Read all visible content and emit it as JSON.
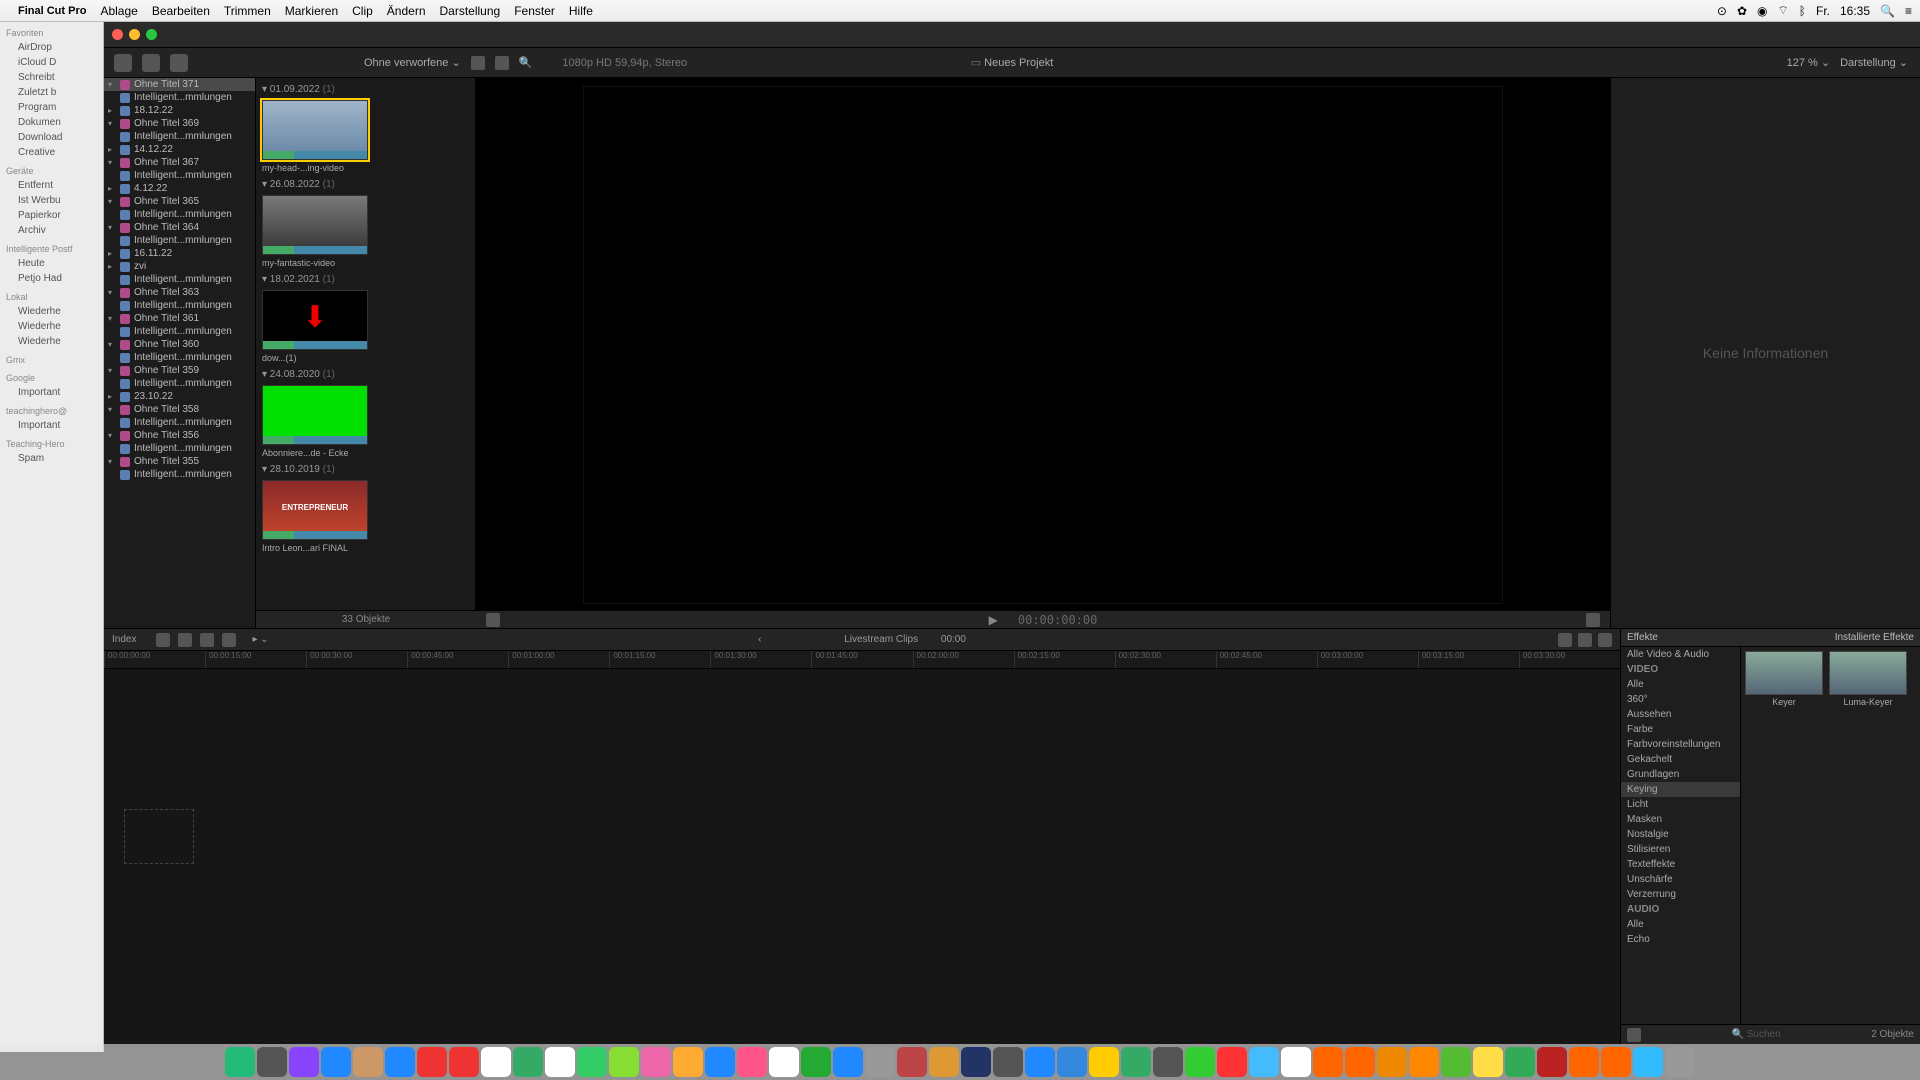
{
  "menubar": {
    "app": "Final Cut Pro",
    "items": [
      "Ablage",
      "Bearbeiten",
      "Trimmen",
      "Markieren",
      "Clip",
      "Ändern",
      "Darstellung",
      "Fenster",
      "Hilfe"
    ],
    "right": {
      "day": "Fr.",
      "time": "16:35"
    }
  },
  "finder": {
    "sections": [
      {
        "header": "Favoriten",
        "items": [
          "AirDrop",
          "iCloud D",
          "Schreibt",
          "Zuletzt b",
          "Program",
          "Dokumen",
          "Download",
          "Creative"
        ]
      },
      {
        "header": "Geräte",
        "items": [
          "Entfernt"
        ]
      },
      {
        "header": "",
        "items": [
          "Ist Werbu",
          "Papierkor",
          "Archiv"
        ]
      },
      {
        "header": "Intelligente Postf",
        "items": [
          "Heute",
          "Petjo Had"
        ]
      },
      {
        "header": "Lokal",
        "items": [
          "Wiederhe",
          "Wiederhe",
          "Wiederhe"
        ]
      },
      {
        "header": "Gmx",
        "items": []
      },
      {
        "header": "Google",
        "items": [
          "Important"
        ]
      },
      {
        "header": "teachinghero@",
        "items": [
          "Important"
        ]
      },
      {
        "header": "Teaching-Hero",
        "items": [
          "Spam"
        ]
      }
    ]
  },
  "toolbar": {
    "filter": "Ohne verworfene",
    "format": "1080p HD 59,94p, Stereo",
    "project": "Neues Projekt",
    "zoom": "127 %",
    "view": "Darstellung"
  },
  "library": {
    "items": [
      {
        "t": "▾",
        "ic": "star",
        "label": "Ohne Titel 371",
        "sel": true
      },
      {
        "t": "",
        "ic": "",
        "label": "Intelligent...mmlungen"
      },
      {
        "t": "▸",
        "ic": "",
        "label": "18.12.22"
      },
      {
        "t": "▾",
        "ic": "star",
        "label": "Ohne Titel 369"
      },
      {
        "t": "",
        "ic": "",
        "label": "Intelligent...mmlungen"
      },
      {
        "t": "▸",
        "ic": "",
        "label": "14.12.22"
      },
      {
        "t": "▾",
        "ic": "star",
        "label": "Ohne Titel 367"
      },
      {
        "t": "",
        "ic": "",
        "label": "Intelligent...mmlungen"
      },
      {
        "t": "▸",
        "ic": "",
        "label": "4.12.22"
      },
      {
        "t": "▾",
        "ic": "star",
        "label": "Ohne Titel 365"
      },
      {
        "t": "",
        "ic": "",
        "label": "Intelligent...mmlungen"
      },
      {
        "t": "▾",
        "ic": "star",
        "label": "Ohne Titel 364"
      },
      {
        "t": "",
        "ic": "",
        "label": "Intelligent...mmlungen"
      },
      {
        "t": "▸",
        "ic": "",
        "label": "16.11.22"
      },
      {
        "t": "▸",
        "ic": "",
        "label": "zvi"
      },
      {
        "t": "",
        "ic": "",
        "label": "Intelligent...mmlungen"
      },
      {
        "t": "▾",
        "ic": "star",
        "label": "Ohne Titel 363"
      },
      {
        "t": "",
        "ic": "",
        "label": "Intelligent...mmlungen"
      },
      {
        "t": "▾",
        "ic": "star",
        "label": "Ohne Titel 361"
      },
      {
        "t": "",
        "ic": "",
        "label": "Intelligent...mmlungen"
      },
      {
        "t": "▾",
        "ic": "star",
        "label": "Ohne Titel 360"
      },
      {
        "t": "",
        "ic": "",
        "label": "Intelligent...mmlungen"
      },
      {
        "t": "▾",
        "ic": "star",
        "label": "Ohne Titel 359"
      },
      {
        "t": "",
        "ic": "",
        "label": "Intelligent...mmlungen"
      },
      {
        "t": "▸",
        "ic": "",
        "label": "23.10.22"
      },
      {
        "t": "▾",
        "ic": "star",
        "label": "Ohne Titel 358"
      },
      {
        "t": "",
        "ic": "",
        "label": "Intelligent...mmlungen"
      },
      {
        "t": "▾",
        "ic": "star",
        "label": "Ohne Titel 356"
      },
      {
        "t": "",
        "ic": "",
        "label": "Intelligent...mmlungen"
      },
      {
        "t": "▾",
        "ic": "star",
        "label": "Ohne Titel 355"
      },
      {
        "t": "",
        "ic": "",
        "label": "Intelligent...mmlungen"
      }
    ]
  },
  "browser": {
    "groups": [
      {
        "date": "01.09.2022",
        "count": "(1)",
        "thumbs": [
          {
            "name": "my-head-...ing-video",
            "sel": true,
            "bg": "linear-gradient(#a0b4c8,#6a8aa8)"
          }
        ]
      },
      {
        "date": "26.08.2022",
        "count": "(1)",
        "thumbs": [
          {
            "name": "my-fantastic-video",
            "bg": "linear-gradient(#7a7a7a,#3a3a3a)"
          }
        ]
      },
      {
        "date": "18.02.2021",
        "count": "(1)",
        "thumbs": [
          {
            "name": "dow...(1)",
            "bg": "#000",
            "arrow": true
          }
        ]
      },
      {
        "date": "24.08.2020",
        "count": "(1)",
        "thumbs": [
          {
            "name": "Abonniere...de - Ecke",
            "bg": "#00e000"
          }
        ]
      },
      {
        "date": "28.10.2019",
        "count": "(1)",
        "thumbs": [
          {
            "name": "Intro Leon...ari FINAL",
            "bg": "linear-gradient(#8b2a2a,#c0442a)",
            "text": "ENTREPRENEUR"
          }
        ]
      }
    ],
    "footer": "33 Objekte"
  },
  "viewer": {
    "timecode": "00:00:00:00"
  },
  "inspector": {
    "empty": "Keine Informationen"
  },
  "timeline": {
    "index": "Index",
    "title": "Livestream Clips",
    "duration": "00:00",
    "ruler": [
      "00:00:00:00",
      "00:00:15:00",
      "00:00:30:00",
      "00:00:45:00",
      "00:01:00:00",
      "00:01:15:00",
      "00:01:30:00",
      "00:01:45:00",
      "00:02:00:00",
      "00:02:15:00",
      "00:02:30:00",
      "00:02:45:00",
      "00:03:00:00",
      "00:03:15:00",
      "00:03:30:00"
    ]
  },
  "effects": {
    "title": "Effekte",
    "installed": "Installierte Effekte",
    "categories": [
      {
        "label": "Alle Video & Audio"
      },
      {
        "label": "VIDEO",
        "hdr": true
      },
      {
        "label": "Alle"
      },
      {
        "label": "360°"
      },
      {
        "label": "Aussehen"
      },
      {
        "label": "Farbe"
      },
      {
        "label": "Farbvoreinstellungen"
      },
      {
        "label": "Gekachelt"
      },
      {
        "label": "Grundlagen"
      },
      {
        "label": "Keying",
        "sel": true
      },
      {
        "label": "Licht"
      },
      {
        "label": "Masken"
      },
      {
        "label": "Nostalgie"
      },
      {
        "label": "Stilisieren"
      },
      {
        "label": "Texteffekte"
      },
      {
        "label": "Unschärfe"
      },
      {
        "label": "Verzerrung"
      },
      {
        "label": "AUDIO",
        "hdr": true
      },
      {
        "label": "Alle"
      },
      {
        "label": "Echo"
      }
    ],
    "items": [
      {
        "label": "Keyer"
      },
      {
        "label": "Luma-Keyer"
      }
    ],
    "search_placeholder": "Suchen",
    "footer_count": "2 Objekte"
  }
}
